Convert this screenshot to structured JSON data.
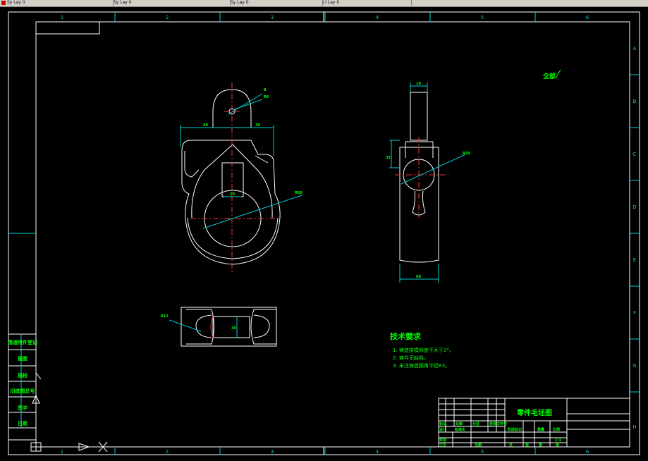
{
  "tabs": [
    {
      "label": "Sy Lay 0"
    },
    {
      "label": "Sy Lay 0"
    },
    {
      "label": "Sy Lay 0"
    },
    {
      "label": "Ll Lay 0"
    }
  ],
  "border": {
    "columns": [
      "1",
      "2",
      "3",
      "4",
      "5",
      "6"
    ],
    "rows": [
      "A",
      "B",
      "C",
      "D",
      "E",
      "F",
      "G",
      "H"
    ]
  },
  "views": {
    "front": {
      "dim_top_left": "40",
      "dim_top_right": "30",
      "dim_slot": "10",
      "dim_hole": "R50",
      "dim_pin": "8",
      "dim_pin2": "R6"
    },
    "side": {
      "dim_top": "10",
      "dim_height": "33",
      "dim_radius": "R30",
      "dim_bottom": "60"
    },
    "bottom": {
      "dim_radius": "R11",
      "dim_inner": "30"
    }
  },
  "note_allround": "全部",
  "tech": {
    "title": "技术要求",
    "items": [
      "1. 铸造拔模斜度不大于3°。",
      "2. 铸件无缺陷。",
      "3. 未注铸造圆角半径R3。"
    ]
  },
  "left_strip": [
    "借通用件登记",
    "旧底图总号",
    "签字",
    "日期",
    "描图",
    "描校"
  ],
  "left_strip_visible": [
    "借通用件登记",
    "描图",
    "描校",
    "旧底图总号",
    "签字",
    "日期"
  ],
  "title_block": {
    "part_name": "零件毛坯图",
    "labels": [
      "标记",
      "处数",
      "分区",
      "更改文件号",
      "签名",
      "年月日",
      "设计",
      "标准化",
      "审核",
      "工艺",
      "日期",
      "阶段标记",
      "重量",
      "比例",
      "共",
      "张",
      "第",
      "张"
    ],
    "scale": "1:1"
  }
}
